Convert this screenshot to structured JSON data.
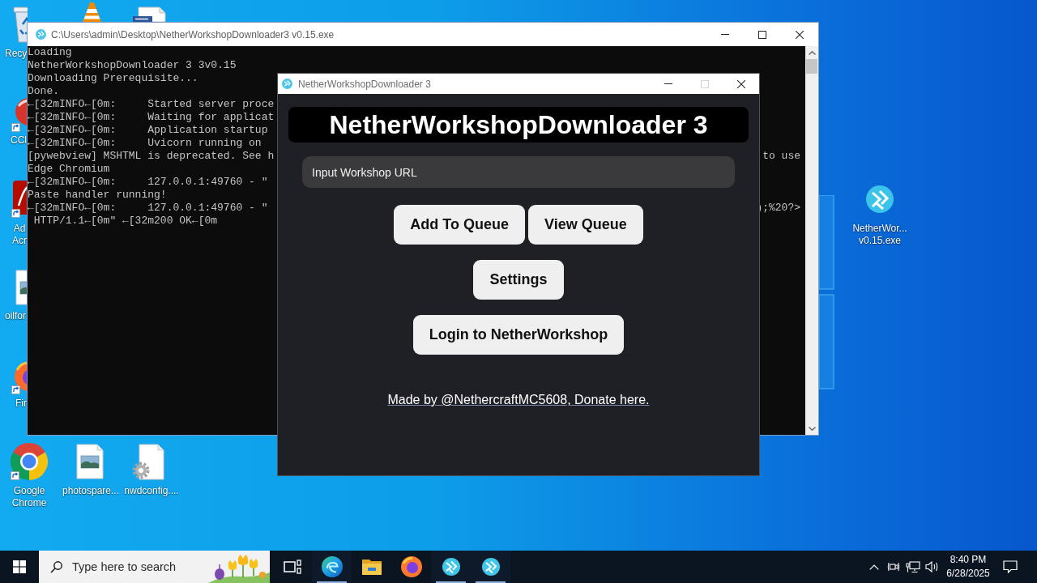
{
  "desktop": {
    "icons": [
      {
        "kind": "recycle-bin",
        "label": "Recy"
      },
      {
        "kind": "vlc"
      },
      {
        "kind": "document"
      },
      {
        "kind": "ccleaner",
        "label": "CCl"
      },
      {
        "kind": "acrobat",
        "label": "Ad Acr"
      },
      {
        "kind": "image-file",
        "label": "oilfor"
      },
      {
        "kind": "firefox",
        "label": "Fir"
      },
      {
        "kind": "chrome",
        "label": "Google Chrome"
      },
      {
        "kind": "image-file",
        "label": "photospare..."
      },
      {
        "kind": "config-file",
        "label": "nwdconfig...."
      },
      {
        "kind": "app",
        "label": "NetherWor... v0.15.exe"
      }
    ]
  },
  "console_window": {
    "title": "C:\\Users\\admin\\Desktop\\NetherWorkshopDownloader3 v0.15.exe",
    "controls": [
      {
        "kind": "minimize",
        "disabled": false
      },
      {
        "kind": "maximize",
        "disabled": false
      },
      {
        "kind": "close",
        "disabled": false
      }
    ],
    "lines": [
      {
        "text": "Loading"
      },
      {
        "text": "NetherWorkshopDownloader 3 3v0.15"
      },
      {
        "text": "Downloading Prerequisite..."
      },
      {
        "text": "Done."
      },
      {
        "text": "←[32mINFO←[0m:     Started server proce"
      },
      {
        "text": "←[32mINFO←[0m:     Waiting for applicat"
      },
      {
        "text": "←[32mINFO←[0m:     Application startup"
      },
      {
        "text": "←[32mINFO←[0m:     Uvicorn running on"
      },
      {
        "text": "[pywebview] MSHTML is deprecated. See h",
        "tail": "to use"
      },
      {
        "text": "Edge Chromium"
      },
      {
        "text": "←[32mINFO←[0m:     127.0.0.1:49760 - \""
      },
      {
        "text": "Paste handler running!"
      },
      {
        "text": "←[32mINFO←[0m:     127.0.0.1:49760 - \"",
        "tail": ");%20?>"
      },
      {
        "text": " HTTP/1.1←[0m\" ←[32m200 OK←[0m"
      }
    ]
  },
  "app_window": {
    "title": "NetherWorkshopDownloader 3",
    "controls": [
      {
        "kind": "minimize",
        "disabled": false
      },
      {
        "kind": "maximize",
        "disabled": true
      },
      {
        "kind": "close",
        "disabled": false
      }
    ],
    "heading": "NetherWorkshopDownloader 3",
    "url_field": {
      "placeholder": "Input Workshop URL"
    },
    "button_rows": [
      {
        "buttons": [
          "Add To Queue",
          "View Queue"
        ]
      },
      {
        "buttons": [
          "Settings"
        ]
      },
      {
        "buttons": [
          "Login to NetherWorkshop"
        ]
      }
    ],
    "footer_link": "Made by @NethercraftMC5608, Donate here."
  },
  "taskbar": {
    "search": {
      "placeholder": "Type here to search"
    },
    "buttons": [
      {
        "kind": "task-view",
        "running": false
      },
      {
        "kind": "edge",
        "running": true
      },
      {
        "kind": "file-explorer",
        "running": false
      },
      {
        "kind": "firefox",
        "running": false
      },
      {
        "kind": "app",
        "running": true
      },
      {
        "kind": "app",
        "running": true
      }
    ],
    "clock": {
      "time": "8:40 PM",
      "date": "6/28/2025"
    }
  }
}
